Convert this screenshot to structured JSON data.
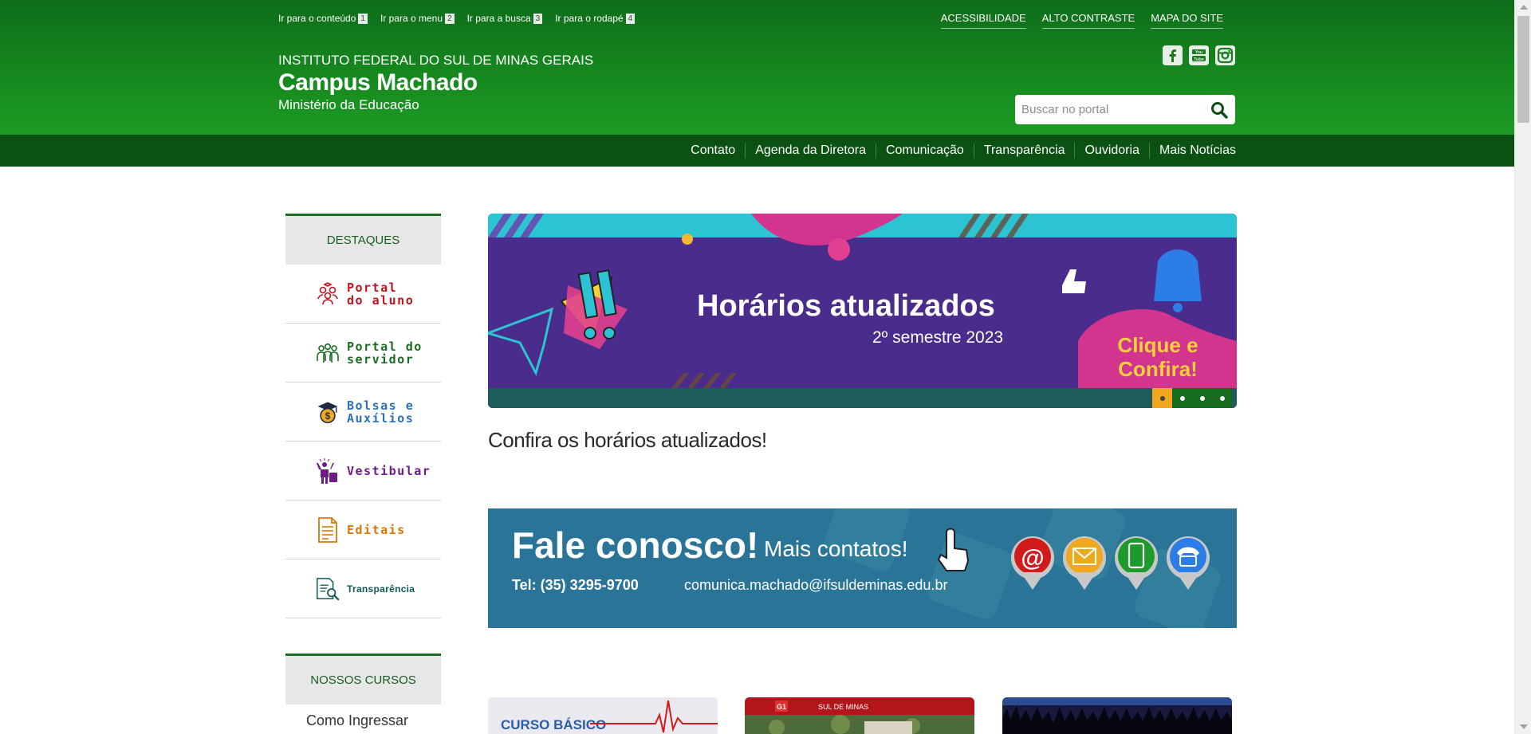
{
  "skip_links": [
    {
      "label": "Ir para o conteúdo",
      "num": "1"
    },
    {
      "label": "Ir para o menu",
      "num": "2"
    },
    {
      "label": "Ir para a busca",
      "num": "3"
    },
    {
      "label": "Ir para o rodapé",
      "num": "4"
    }
  ],
  "top_links": [
    "ACESSIBILIDADE",
    "ALTO CONTRASTE",
    "MAPA DO SITE"
  ],
  "brand": {
    "institution": "INSTITUTO FEDERAL DO SUL DE MINAS GERAIS",
    "campus": "Campus Machado",
    "ministry": "Ministério da Educação"
  },
  "social": [
    {
      "icon": "facebook-icon",
      "glyph": "f"
    },
    {
      "icon": "youtube-icon",
      "glyph": "▶"
    },
    {
      "icon": "instagram-icon",
      "glyph": "◎"
    }
  ],
  "search": {
    "placeholder": "Buscar no portal"
  },
  "nav": [
    "Contato",
    "Agenda da Diretora",
    "Comunicação",
    "Transparência",
    "Ouvidoria",
    "Mais Notícias"
  ],
  "sidebar": {
    "highlights_title": "DESTAQUES",
    "items": [
      {
        "line1": "Portal",
        "line2": "do aluno",
        "color": "#c1121f"
      },
      {
        "line1": "Portal do",
        "line2": "servidor",
        "color": "#1b6b23"
      },
      {
        "line1": "Bolsas e",
        "line2": "Auxílios",
        "color": "#2c71b8"
      },
      {
        "line1": "Vestibular",
        "line2": "",
        "color": "#6d1d8a"
      },
      {
        "line1": "Editais",
        "line2": "",
        "color": "#d97706"
      },
      {
        "line1": "Transparência",
        "line2": "",
        "color": "#0e5a55"
      }
    ],
    "courses_title": "NOSSOS CURSOS",
    "courses_first": "Como Ingressar"
  },
  "banner": {
    "title": "Horários atualizados",
    "subtitle": "2º semestre 2023",
    "cta_line1": "Clique e",
    "cta_line2": "Confira!",
    "active_slide": 1,
    "slide_count": 4
  },
  "headline": "Confira os horários atualizados!",
  "contact_banner": {
    "title": "Fale conosco!",
    "more": "Mais contatos!",
    "phone": "Tel: (35) 3295-9700",
    "email": "comunica.machado@ifsuldeminas.edu.br"
  },
  "cards": [
    {
      "label": "CURSO BÁSICO"
    },
    {
      "label": "SUL DE MINAS",
      "badge": "G1"
    },
    {
      "label": ""
    }
  ],
  "colors": {
    "header_green": "#16881e",
    "nav_green": "#0b5212",
    "banner_purple": "#4a2c8c",
    "contact_blue": "#2a7498",
    "accent_orange": "#f0a81d"
  }
}
